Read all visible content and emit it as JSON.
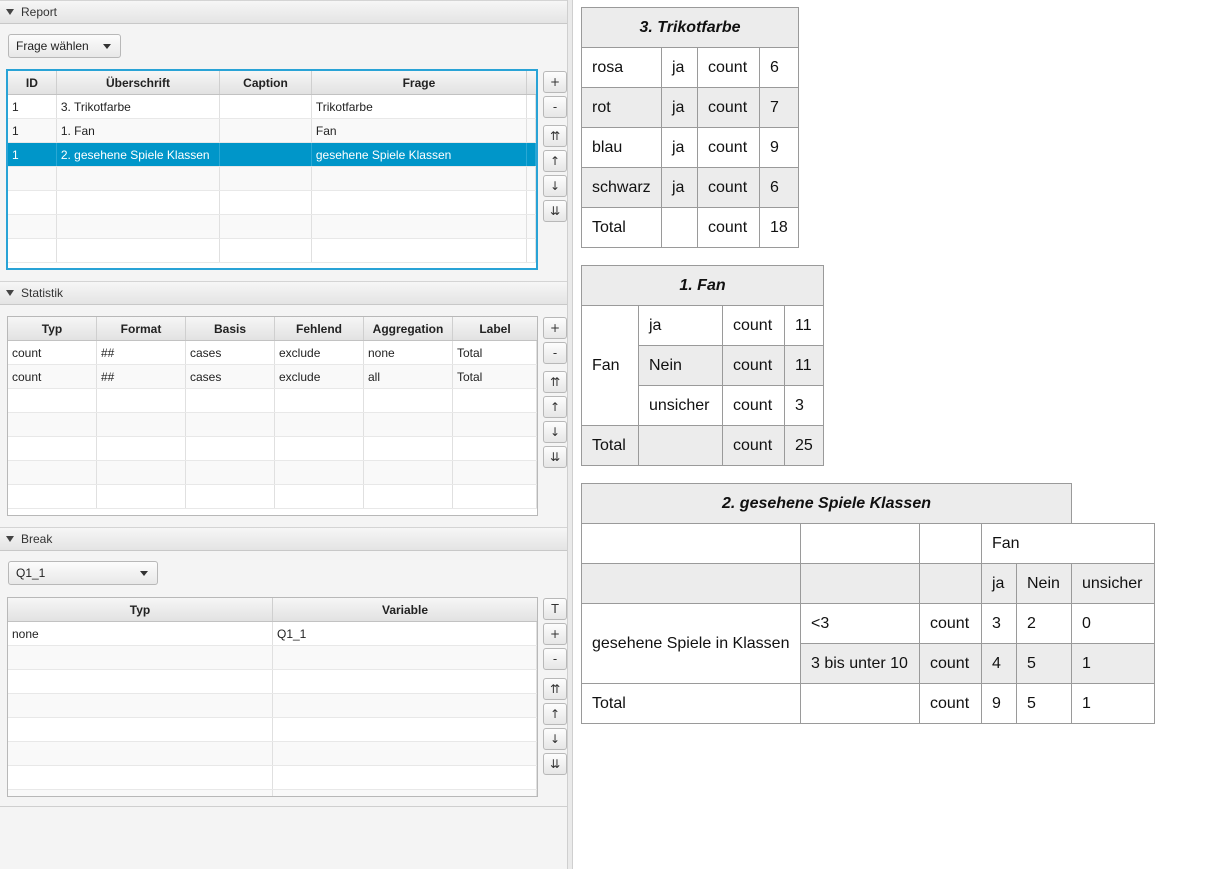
{
  "report": {
    "header": "Report",
    "combo": "Frage wählen",
    "columns": [
      "ID",
      "Überschrift",
      "Caption",
      "Frage"
    ],
    "rows": [
      [
        "1",
        "3. Trikotfarbe",
        "",
        "Trikotfarbe"
      ],
      [
        "1",
        "1. Fan",
        "",
        "Fan"
      ],
      [
        "1",
        "2. gesehene Spiele Klassen",
        "",
        "gesehene Spiele Klassen"
      ]
    ]
  },
  "statistik": {
    "header": "Statistik",
    "columns": [
      "Typ",
      "Format",
      "Basis",
      "Fehlend",
      "Aggregation",
      "Label"
    ],
    "rows": [
      [
        "count",
        "##",
        "cases",
        "exclude",
        "none",
        "Total"
      ],
      [
        "count",
        "##",
        "cases",
        "exclude",
        "all",
        "Total"
      ]
    ]
  },
  "break": {
    "header": "Break",
    "combo": "Q1_1",
    "columns": [
      "Typ",
      "Variable"
    ],
    "rows": [
      [
        "none",
        "Q1_1"
      ]
    ]
  },
  "buttons": {
    "add": "+",
    "remove": "-",
    "top": "⇈",
    "up": "↑",
    "down": "↓",
    "bottom": "⇊",
    "t": "T"
  },
  "output": {
    "trikot": {
      "title": "3. Trikotfarbe",
      "rows": [
        [
          "rosa",
          "ja",
          "count",
          "6"
        ],
        [
          "rot",
          "ja",
          "count",
          "7"
        ],
        [
          "blau",
          "ja",
          "count",
          "9"
        ],
        [
          "schwarz",
          "ja",
          "count",
          "6"
        ],
        [
          "Total",
          "",
          "count",
          "18"
        ]
      ]
    },
    "fan": {
      "title": "1. Fan",
      "group": "Fan",
      "rows": [
        [
          "ja",
          "count",
          "11"
        ],
        [
          "Nein",
          "count",
          "11"
        ],
        [
          "unsicher",
          "count",
          "3"
        ]
      ],
      "total": [
        "Total",
        "",
        "count",
        "25"
      ]
    },
    "spiele": {
      "title": "2. gesehene Spiele Klassen",
      "col_group": "Fan",
      "col_heads": [
        "ja",
        "Nein",
        "unsicher"
      ],
      "row_group": "gesehene Spiele in Klassen",
      "rows": [
        [
          "<3",
          "count",
          "3",
          "2",
          "0"
        ],
        [
          "3 bis unter 10",
          "count",
          "4",
          "5",
          "1"
        ]
      ],
      "total": [
        "Total",
        "",
        "count",
        "9",
        "5",
        "1"
      ]
    }
  }
}
